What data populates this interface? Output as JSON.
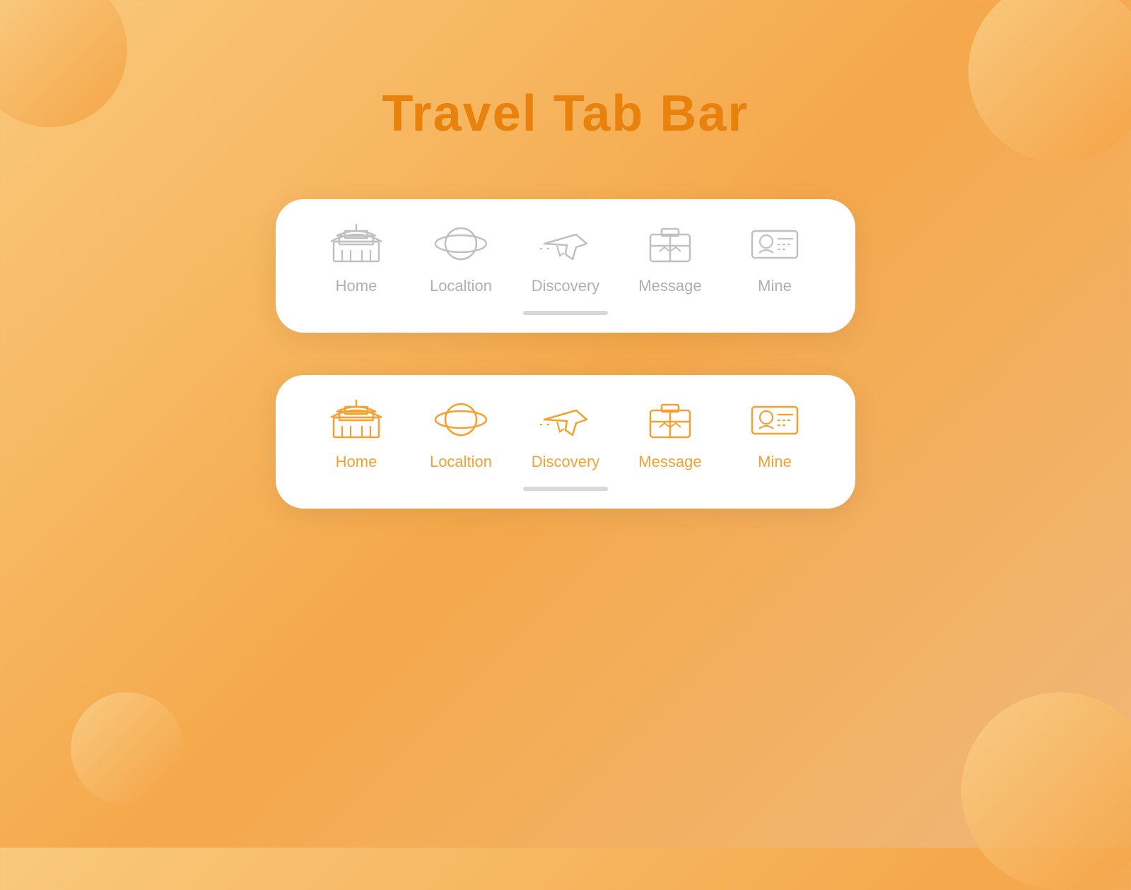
{
  "page": {
    "title": "Travel Tab Bar",
    "title_color": "#e8820c"
  },
  "tab_bar_inactive": {
    "tabs": [
      {
        "id": "home",
        "label": "Home",
        "active": false
      },
      {
        "id": "location",
        "label": "Localtion",
        "active": false
      },
      {
        "id": "discovery",
        "label": "Discovery",
        "active": false
      },
      {
        "id": "message",
        "label": "Message",
        "active": false
      },
      {
        "id": "mine",
        "label": "Mine",
        "active": false
      }
    ]
  },
  "tab_bar_active": {
    "tabs": [
      {
        "id": "home",
        "label": "Home",
        "active": true
      },
      {
        "id": "location",
        "label": "Localtion",
        "active": true
      },
      {
        "id": "discovery",
        "label": "Discovery",
        "active": true
      },
      {
        "id": "message",
        "label": "Message",
        "active": true
      },
      {
        "id": "mine",
        "label": "Mine",
        "active": true
      }
    ]
  },
  "accent_color": "#f5a030",
  "inactive_color": "#b0b0b0"
}
